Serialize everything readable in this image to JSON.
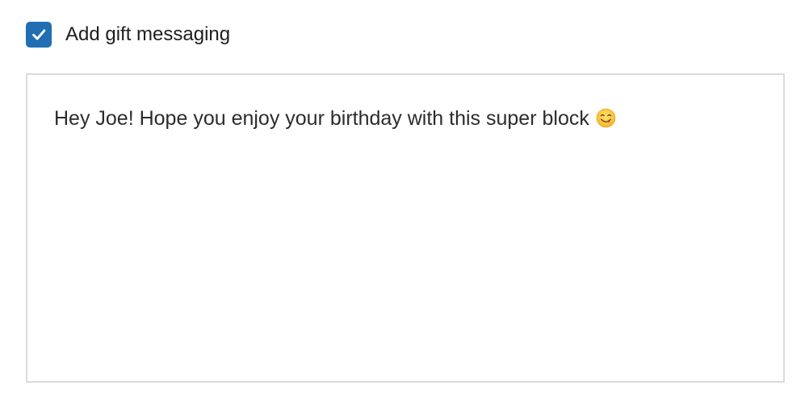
{
  "gift_option": {
    "checked": true,
    "label": "Add gift messaging"
  },
  "gift_message": {
    "value": "Hey Joe! Hope you enjoy your birthday with this super block",
    "emoji_icon": "smiling-face-savoring-food-icon"
  },
  "colors": {
    "checkbox_fill": "#1f6fb2",
    "text": "#1e1e1e",
    "field_border": "#dcdcde"
  }
}
